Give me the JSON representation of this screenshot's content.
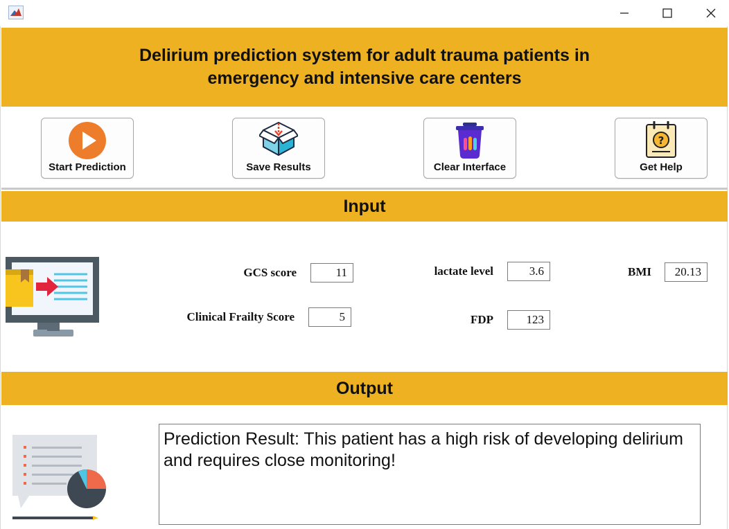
{
  "window": {
    "app_icon": "matlab-icon",
    "controls": [
      "minimize-icon",
      "maximize-icon",
      "close-icon"
    ]
  },
  "header": {
    "title": "Delirium prediction system for adult trauma patients in emergency and intensive care centers"
  },
  "toolbar": {
    "start_label": "Start Prediction",
    "save_label": "Save Results",
    "clear_label": "Clear Interface",
    "help_label": "Get Help",
    "icons": [
      "play-icon",
      "box-download-icon",
      "trash-bin-icon",
      "help-clipboard-icon"
    ]
  },
  "input": {
    "section_title": "Input",
    "gcs_label": "GCS score",
    "gcs_value": "11",
    "lactate_label": "lactate level",
    "lactate_value": "3.6",
    "bmi_label": "BMI",
    "bmi_value": "20.13",
    "cfs_label": "Clinical Frailty Score",
    "cfs_value": "5",
    "fdp_label": "FDP",
    "fdp_value": "123"
  },
  "output": {
    "section_title": "Output",
    "result_text": "Prediction Result: This patient has a high risk of developing delirium and requires close monitoring!"
  },
  "colors": {
    "accent": "#edb121",
    "play": "#ee7d2b",
    "bin": "#5a2bd0",
    "monitor_screen": "#f0f6fb",
    "report": "#e0e3e8"
  }
}
